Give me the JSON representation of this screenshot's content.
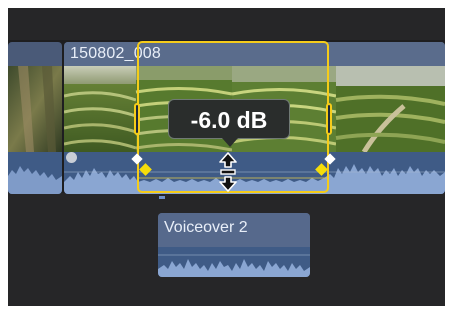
{
  "timeline": {
    "primary_clip": {
      "name": "150802_008"
    },
    "volume_readout": {
      "value": "-6.0 dB"
    },
    "connected_clip": {
      "name": "Voiceover 2"
    }
  },
  "colors": {
    "background": "#262628",
    "clip_header": "#5a6c8c",
    "audio_waveform": "#3f5b86",
    "range_selection": "#f5cc1a",
    "keyframe": "#f5dd0a"
  },
  "icons": [
    "resize-vertical-icon",
    "marker-icon",
    "keyframe-icon"
  ]
}
